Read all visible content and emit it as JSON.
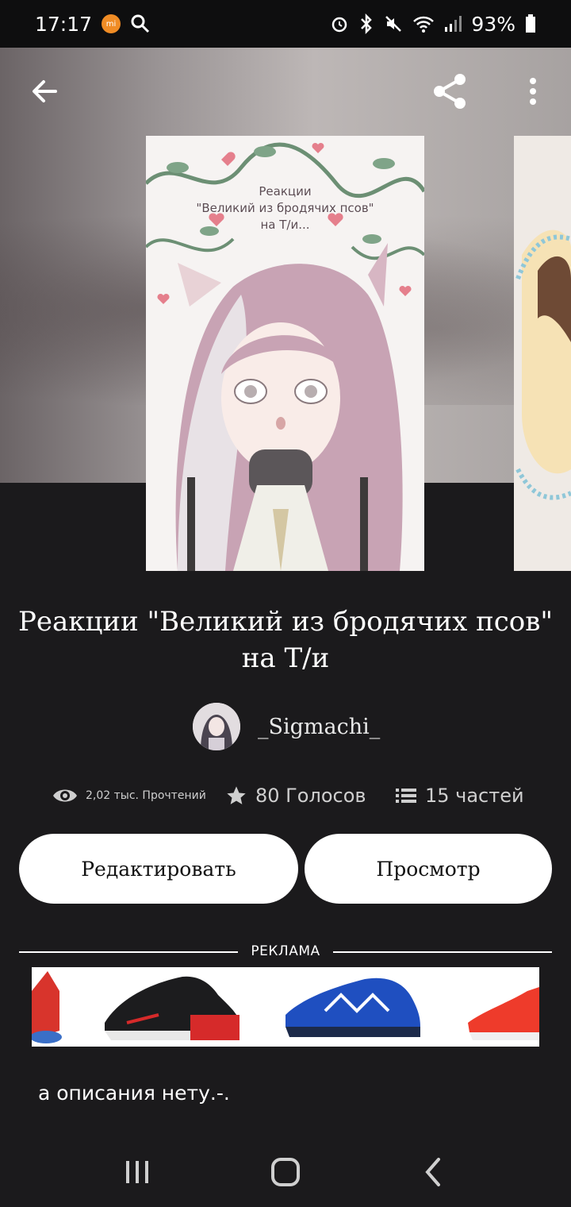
{
  "status_bar": {
    "time": "17:17",
    "battery": "93%",
    "icons": [
      "mi-icon",
      "search-icon",
      "alarm-icon",
      "bluetooth-icon",
      "mute-icon",
      "wifi-icon",
      "signal-icon",
      "battery-icon"
    ]
  },
  "cover": {
    "text_line1": "Реакции",
    "text_line2": "\"Великий из бродячих псов\"",
    "text_line3": "на Т/и..."
  },
  "story": {
    "title": "Реакции \"Великий из бродячих псов\" на Т/и",
    "author": "_Sigmachi_"
  },
  "stats": {
    "reads": "2,02 тыс. Прочтений",
    "votes": "80 Голосов",
    "parts": "15 частей"
  },
  "actions": {
    "edit": "Редактировать",
    "view": "Просмотр"
  },
  "ad": {
    "label": "РЕКЛАМА"
  },
  "description": "а описания нету.-.",
  "colors": {
    "background": "#1b1a1c",
    "button_bg": "#ffffff"
  }
}
